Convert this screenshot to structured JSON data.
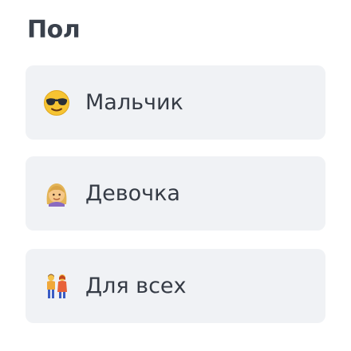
{
  "section": {
    "title": "Пол"
  },
  "options": [
    {
      "label": "Мальчик",
      "icon": "cool-face-icon"
    },
    {
      "label": "Девочка",
      "icon": "woman-face-icon"
    },
    {
      "label": "Для всех",
      "icon": "two-people-icon"
    }
  ],
  "colors": {
    "card_background": "#f0f2f5",
    "text": "#353b45",
    "title": "#3a414c"
  }
}
